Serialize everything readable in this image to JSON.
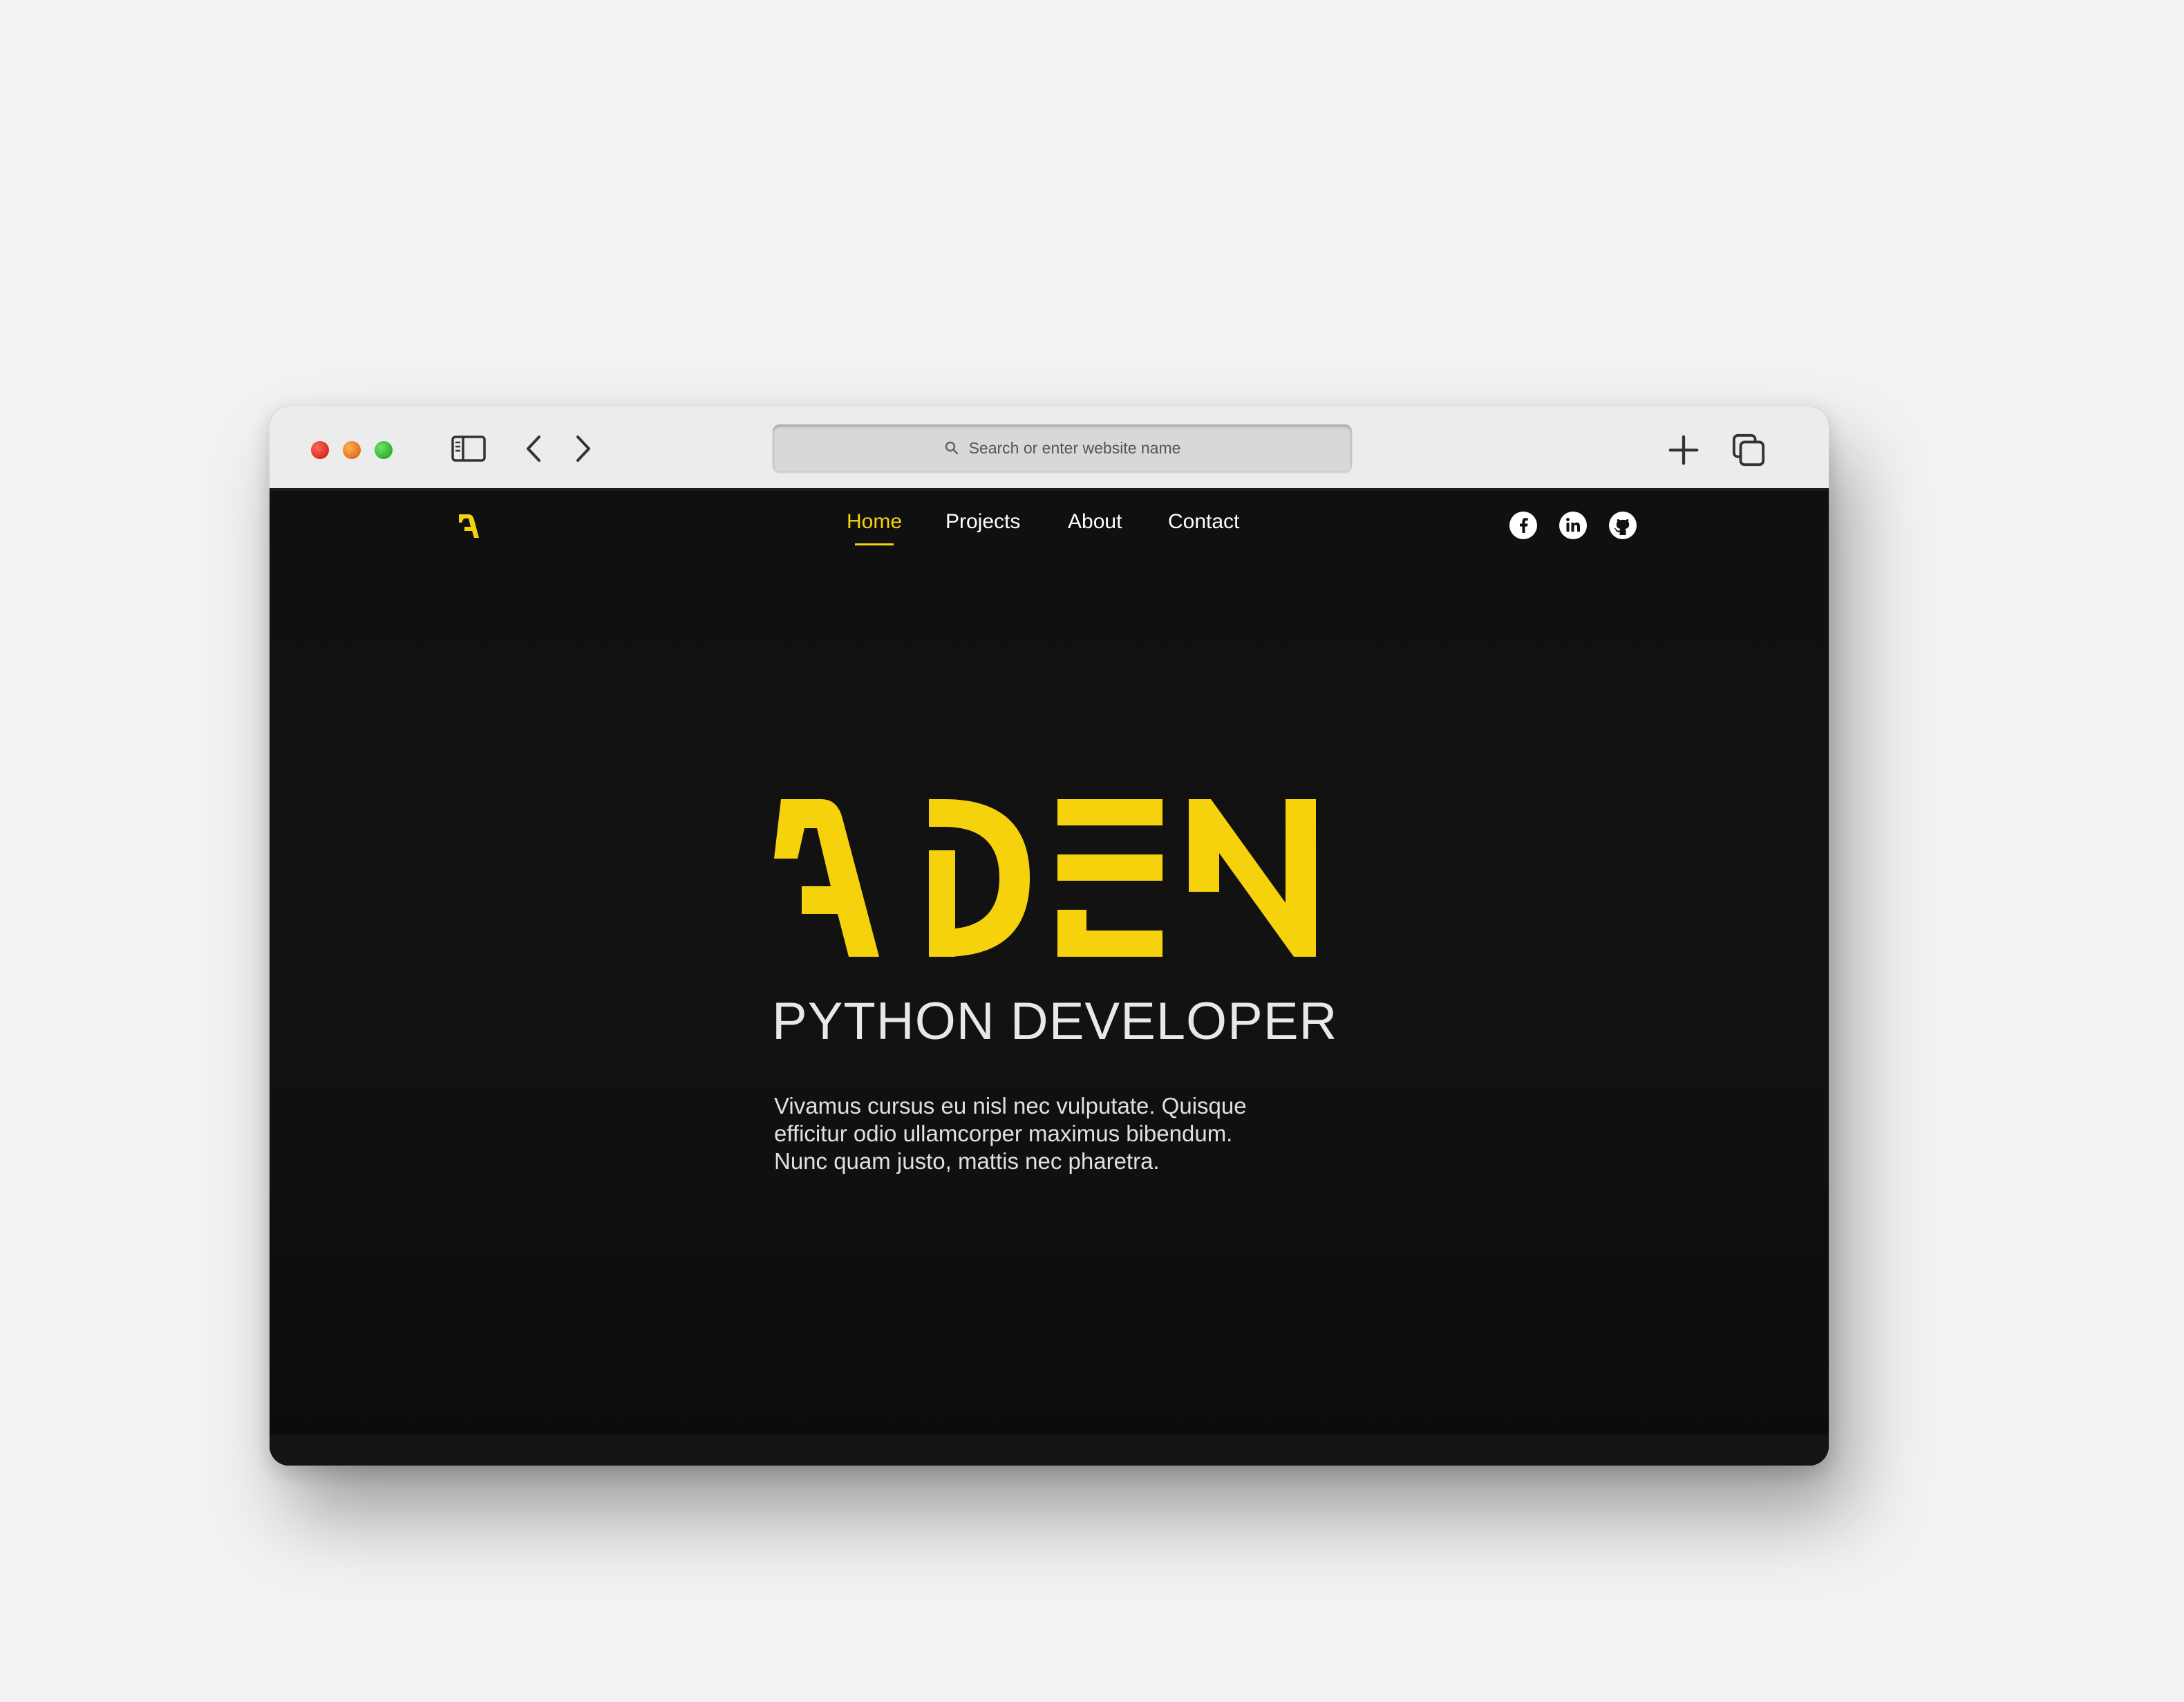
{
  "browser": {
    "address_placeholder": "Search or enter website name"
  },
  "site": {
    "logo_text": "ADEN",
    "nav": [
      {
        "label": "Home",
        "active": true
      },
      {
        "label": "Projects",
        "active": false
      },
      {
        "label": "About",
        "active": false
      },
      {
        "label": "Contact",
        "active": false
      }
    ],
    "social": [
      "facebook-icon",
      "linkedin-icon",
      "github-icon"
    ],
    "accent_color": "#f5d20c"
  },
  "hero": {
    "title": "ADEN",
    "subtitle": "PYTHON DEVELOPER",
    "description_lines": [
      "Vivamus cursus eu nisl nec vulputate. Quisque",
      "efficitur odio ullamcorper maximus bibendum.",
      "Nunc quam justo, mattis nec pharetra."
    ]
  }
}
